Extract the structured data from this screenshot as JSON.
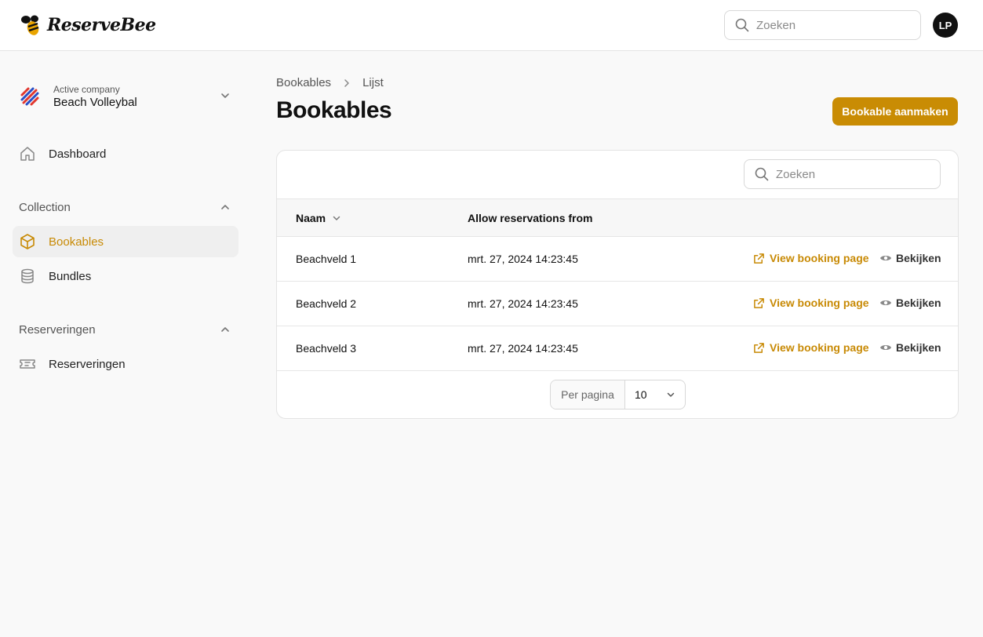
{
  "app": {
    "name": "ReserveBee"
  },
  "header": {
    "search_placeholder": "Zoeken",
    "avatar_initials": "LP"
  },
  "sidebar": {
    "company_label": "Active company",
    "company_name": "Beach Volleybal",
    "dashboard": "Dashboard",
    "groups": [
      {
        "label": "Collection",
        "items": [
          "Bookables",
          "Bundles"
        ]
      },
      {
        "label": "Reserveringen",
        "items": [
          "Reserveringen"
        ]
      }
    ]
  },
  "breadcrumb": [
    "Bookables",
    "Lijst"
  ],
  "page": {
    "title": "Bookables",
    "create_button": "Bookable aanmaken"
  },
  "table": {
    "search_placeholder": "Zoeken",
    "columns": [
      "Naam",
      "Allow reservations from"
    ],
    "action_view": "View booking page",
    "action_look": "Bekijken",
    "rows": [
      {
        "name": "Beachveld 1",
        "from": "mrt. 27, 2024 14:23:45"
      },
      {
        "name": "Beachveld 2",
        "from": "mrt. 27, 2024 14:23:45"
      },
      {
        "name": "Beachveld 3",
        "from": "mrt. 27, 2024 14:23:45"
      }
    ],
    "per_page_label": "Per pagina",
    "per_page_value": "10"
  },
  "colors": {
    "accent": "#c98c04",
    "text": "#111111",
    "background": "#f9f9f9"
  }
}
